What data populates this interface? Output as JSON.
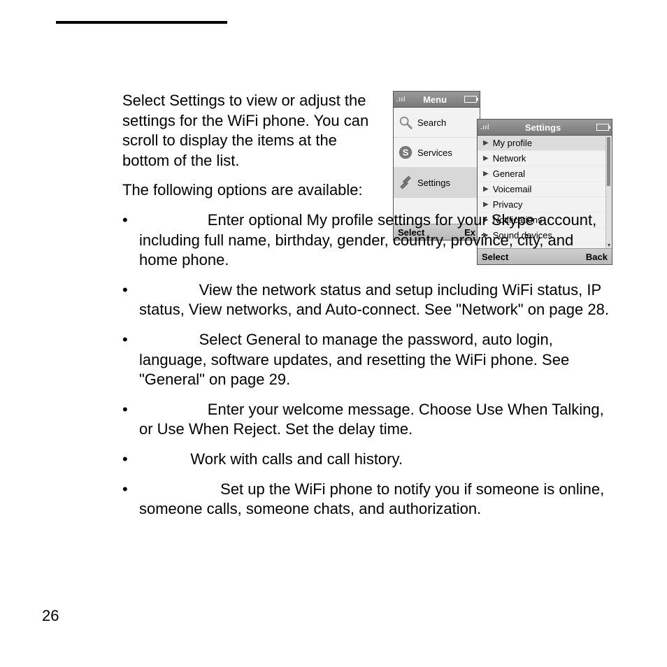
{
  "page_number": "26",
  "paragraphs": {
    "p1": "Select Settings to view or adjust the settings for the WiFi phone. You can scroll to display the items at the bottom of the list.",
    "p2": "The following options are available:"
  },
  "bullets": [
    "Enter optional My profile settings for your Skype account, including full name, birthday, gender, country, province, city, and home phone.",
    "View the network status and setup including WiFi status, IP status, View networks, and Auto-connect. See \"Network\" on page 28.",
    "Select General to manage the password, auto login, language, software updates, and resetting the WiFi phone. See \"General\" on page 29.",
    "Enter your welcome message. Choose Use When Talking, or Use When Reject. Set the delay time.",
    "Work with calls and call history.",
    "Set up the WiFi phone to notify you if someone is online, someone calls, someone chats, and authorization."
  ],
  "bullet_leads": [
    "                Enter optional My profile settings for your Skype account, including full name, birthday, gender, country, province, city, and home phone.",
    "              View the network status and setup including WiFi status, IP status, View networks, and Auto-connect. See \"Network\" on page 28.",
    "              Select General to manage the password, auto login, language, software updates, and resetting the WiFi phone. See \"General\" on page 29.",
    "                Enter your welcome message. Choose Use When Talking, or Use When Reject. Set the delay time.",
    "            Work with calls and call history.",
    "                   Set up the WiFi phone to notify you if someone is online, someone calls, someone chats, and authorization."
  ],
  "figure": {
    "menu": {
      "title": "Menu",
      "items": [
        {
          "icon": "search-icon",
          "label": "Search"
        },
        {
          "icon": "services-icon",
          "label": "Services"
        },
        {
          "icon": "settings-icon",
          "label": "Settings",
          "selected": true
        }
      ],
      "softkey_left": "Select",
      "softkey_right": "Ex"
    },
    "settings": {
      "title": "Settings",
      "items": [
        {
          "label": "My profile",
          "selected": true
        },
        {
          "label": "Network"
        },
        {
          "label": "General"
        },
        {
          "label": "Voicemail"
        },
        {
          "label": "Privacy"
        },
        {
          "label": "Notifications"
        },
        {
          "label": "Sound devices"
        }
      ],
      "softkey_left": "Select",
      "softkey_right": "Back"
    }
  }
}
